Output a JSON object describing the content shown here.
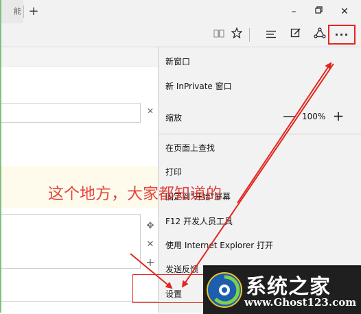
{
  "tabs": {
    "partial_title": "能",
    "new_tab_icon": "plus-icon"
  },
  "window": {
    "minimize": "–",
    "restore": "⧉",
    "close": "✕"
  },
  "toolbar": {
    "reading_view_icon": "book-icon",
    "favorite_icon": "star-icon",
    "hub_icon": "hub-icon",
    "note_icon": "web-note-icon",
    "share_icon": "share-icon",
    "more_label": "···"
  },
  "menu": {
    "new_window": "新窗口",
    "new_inprivate": "新 InPrivate 窗口",
    "zoom_label": "缩放",
    "zoom_value": "100%",
    "find_on_page": "在页面上查找",
    "print": "打印",
    "pin_to_start": "固定到\"开始\"屏幕",
    "dev_tools": "F12 开发人员工具",
    "open_with_ie": "使用 Internet Explorer 打开",
    "send_feedback": "发送反馈",
    "settings": "设置"
  },
  "annotation": {
    "text": "这个地方，大家都知道的"
  },
  "watermark": {
    "title": "系统之家",
    "url": "www.Ghost123.com"
  },
  "colors": {
    "highlight": "#e0261e",
    "menu_bg": "#f2f2f2"
  }
}
